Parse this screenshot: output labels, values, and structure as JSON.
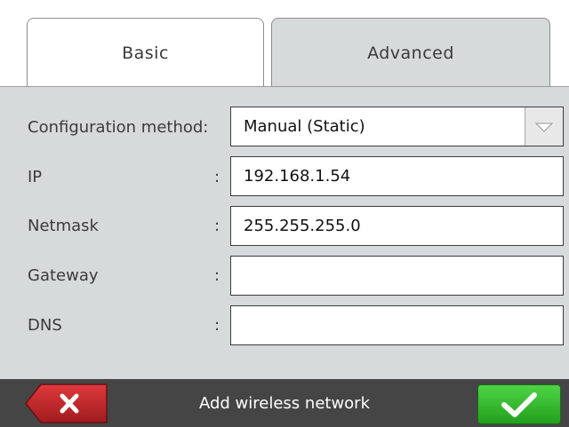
{
  "tabs": [
    {
      "label": "Basic",
      "active": false
    },
    {
      "label": "Advanced",
      "active": true
    }
  ],
  "form": {
    "config_method": {
      "label": "Configuration method:",
      "value": "Manual (Static)"
    },
    "ip": {
      "label": "IP",
      "colon": ":",
      "value": "192.168.1.54"
    },
    "netmask": {
      "label": "Netmask",
      "colon": ":",
      "value": "255.255.255.0"
    },
    "gateway": {
      "label": "Gateway",
      "colon": ":",
      "value": ""
    },
    "dns": {
      "label": "DNS",
      "colon": ":",
      "value": ""
    }
  },
  "bottom_bar": {
    "title": "Add wireless network",
    "cancel_icon": "close-icon",
    "confirm_icon": "checkmark-icon"
  },
  "colors": {
    "panel_bg": "#d6dadb",
    "cancel_red": "#c0282b",
    "confirm_green": "#2fb829",
    "bar_bg": "#454545"
  }
}
